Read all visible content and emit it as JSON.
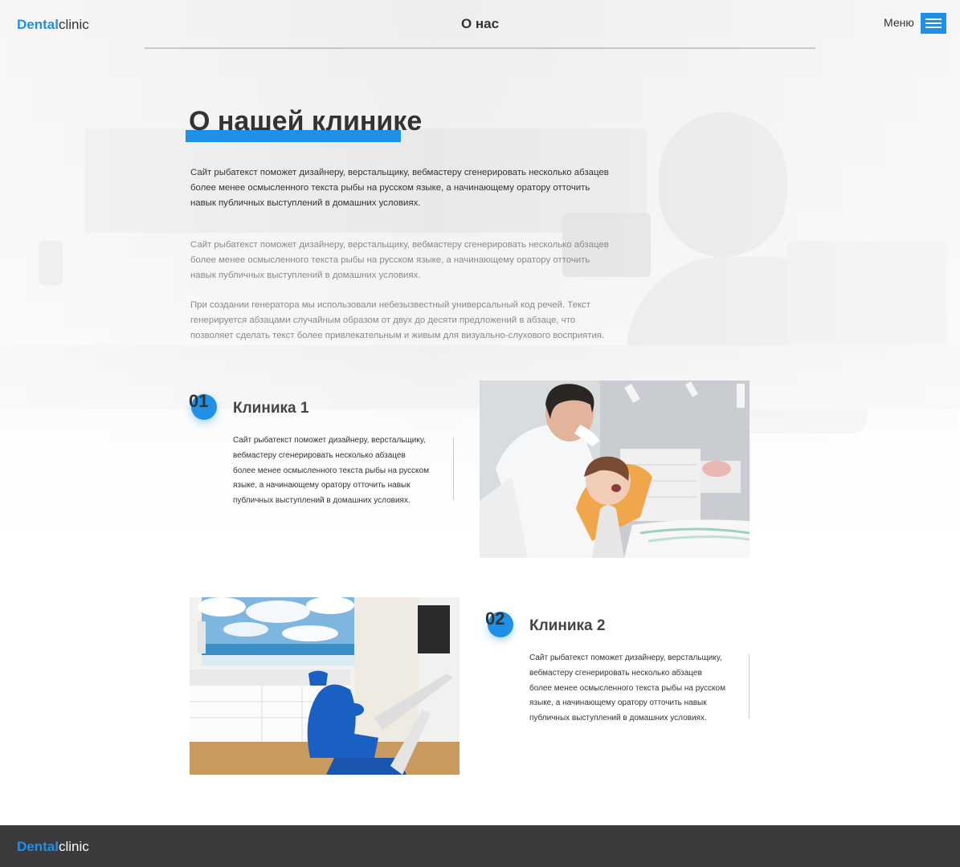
{
  "logo": {
    "brand": "Dental",
    "rest": "clinic"
  },
  "nav": {
    "title": "О нас",
    "menu_label": "Меню",
    "menu_icon": "hamburger-icon"
  },
  "about": {
    "heading": "О нашей клинике",
    "intro": "Сайт рыбатекст поможет дизайнеру, верстальщику, вебмастеру сгенерировать несколько абзацев более менее осмысленного текста рыбы на русском языке, а начинающему оратору отточить навык публичных выступлений в домашних условиях.",
    "para2": "Сайт рыбатекст поможет дизайнеру, верстальщику, вебмастеру сгенерировать несколько абзацев более менее осмысленного текста рыбы на русском языке, а начинающему оратору отточить навык публичных выступлений в домашних условиях.",
    "para3": "При создании генератора мы использовали небезызвестный универсальный код речей. Текст генерируется абзацами случайным образом от двух до десяти предложений в абзаце, что позволяет сделать текст более привлекательным и живым для визуально-слухового восприятия."
  },
  "clinics": [
    {
      "number": "01",
      "title": "Клиника 1",
      "text": "Сайт рыбатекст поможет дизайнеру, верстальщику, вебмастеру сгенерировать несколько абзацев более менее осмысленного текста рыбы на русском языке, а начинающему оратору отточить навык публичных выступлений в домашних условиях.",
      "image": "dentist-with-patient-photo"
    },
    {
      "number": "02",
      "title": "Клиника 2",
      "text": "Сайт рыбатекст поможет дизайнеру, верстальщику, вебмастеру сгенерировать несколько абзацев более менее осмысленного текста рыбы на русском языке, а начинающему оратору отточить навык публичных выступлений в домашних условиях.",
      "image": "dental-office-blue-chair-photo"
    }
  ],
  "footer": {
    "brand": "Dental",
    "rest": "clinic"
  },
  "colors": {
    "accent": "#1e90e8",
    "footer_bg": "#3b3b3d",
    "text": "#333333",
    "muted": "#8a8a8a"
  }
}
